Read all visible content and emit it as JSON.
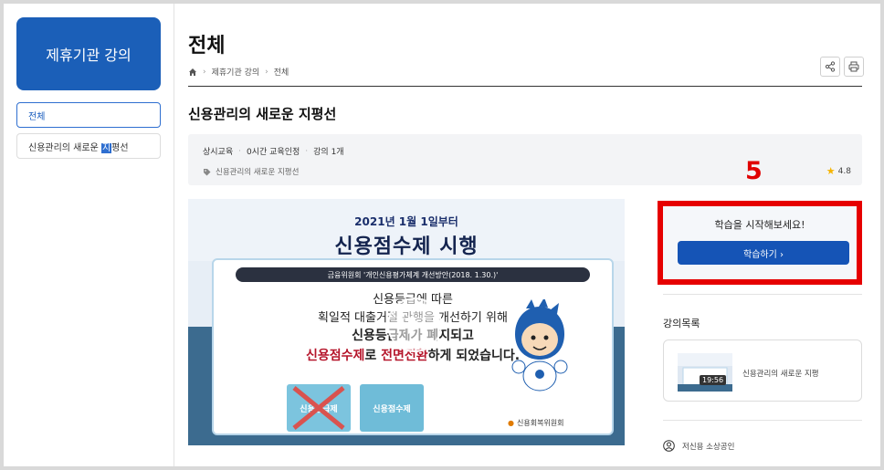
{
  "sidebar": {
    "title": "제휴기관 강의",
    "items": [
      {
        "label": "전체"
      },
      {
        "label_pre": "신용관리의 새로운 ",
        "label_hl": "지",
        "label_post": "평선"
      }
    ]
  },
  "page": {
    "title": "전체",
    "breadcrumb": [
      "제휴기관 강의",
      "전체"
    ],
    "course_title": "신용관리의 새로운 지평선"
  },
  "info": {
    "meta": [
      "상시교육",
      "0시간 교육인정",
      "강의 1개"
    ],
    "tag": "신용관리의 새로운 지평선",
    "rating": "4.8"
  },
  "annotation": {
    "number": "5",
    "color": "#e00000"
  },
  "video": {
    "date": "2021년 1월 1일부터",
    "headline": "신용점수제 시행",
    "banner": "금융위원회 '개인신용평가체계 개선방안(2018. 1.30.)'",
    "line1": "신용등급에 따른",
    "line2": "획일적 대출거절 관행을 개선하기 위해",
    "line3": "신용등급제가 폐지되고",
    "line4_red1": "신용점수제",
    "line4_mid": "로 ",
    "line4_red2": "전면전환",
    "line4_post": "하게 되었습니다.",
    "folder1": "신용등급제",
    "folder2": "신용점수제",
    "org": "신용회복위원회"
  },
  "start": {
    "text": "학습을 시작해보세요!",
    "button": "학습하기 ›"
  },
  "lecture_list": {
    "title": "강의목록",
    "items": [
      {
        "name": "신용관리의 새로운 지평",
        "duration": "19:56"
      }
    ]
  },
  "footer": {
    "label": "저신용 소상공인"
  },
  "colors": {
    "accent": "#1b5fb8",
    "button": "#1554b6",
    "highlight_border": "#e60000"
  }
}
